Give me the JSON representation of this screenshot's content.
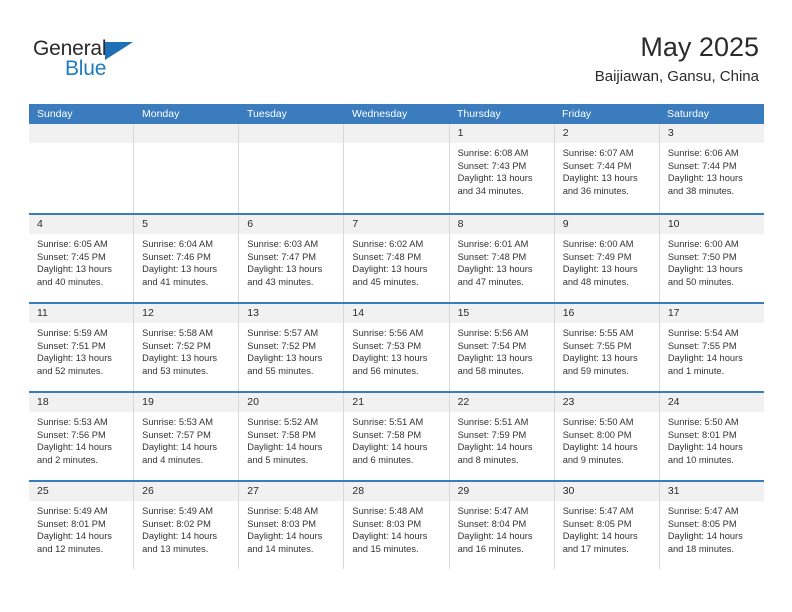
{
  "brand": {
    "name_top": "General",
    "name_bottom": "Blue",
    "triangle_color": "#1f6fb5",
    "blue_color": "#1f7bc1"
  },
  "header": {
    "title": "May 2025",
    "subtitle": "Baijiawan, Gansu, China"
  },
  "theme": {
    "header_blue": "#3b7cbe",
    "day_band": "#f1f1f1",
    "cell_border": "#d8d8d8"
  },
  "weekdays": [
    "Sunday",
    "Monday",
    "Tuesday",
    "Wednesday",
    "Thursday",
    "Friday",
    "Saturday"
  ],
  "weeks": [
    [
      {
        "day": "",
        "empty": true
      },
      {
        "day": "",
        "empty": true
      },
      {
        "day": "",
        "empty": true
      },
      {
        "day": "",
        "empty": true
      },
      {
        "day": "1",
        "sunrise": "Sunrise: 6:08 AM",
        "sunset": "Sunset: 7:43 PM",
        "daylight_1": "Daylight: 13 hours",
        "daylight_2": "and 34 minutes."
      },
      {
        "day": "2",
        "sunrise": "Sunrise: 6:07 AM",
        "sunset": "Sunset: 7:44 PM",
        "daylight_1": "Daylight: 13 hours",
        "daylight_2": "and 36 minutes."
      },
      {
        "day": "3",
        "sunrise": "Sunrise: 6:06 AM",
        "sunset": "Sunset: 7:44 PM",
        "daylight_1": "Daylight: 13 hours",
        "daylight_2": "and 38 minutes."
      }
    ],
    [
      {
        "day": "4",
        "sunrise": "Sunrise: 6:05 AM",
        "sunset": "Sunset: 7:45 PM",
        "daylight_1": "Daylight: 13 hours",
        "daylight_2": "and 40 minutes."
      },
      {
        "day": "5",
        "sunrise": "Sunrise: 6:04 AM",
        "sunset": "Sunset: 7:46 PM",
        "daylight_1": "Daylight: 13 hours",
        "daylight_2": "and 41 minutes."
      },
      {
        "day": "6",
        "sunrise": "Sunrise: 6:03 AM",
        "sunset": "Sunset: 7:47 PM",
        "daylight_1": "Daylight: 13 hours",
        "daylight_2": "and 43 minutes."
      },
      {
        "day": "7",
        "sunrise": "Sunrise: 6:02 AM",
        "sunset": "Sunset: 7:48 PM",
        "daylight_1": "Daylight: 13 hours",
        "daylight_2": "and 45 minutes."
      },
      {
        "day": "8",
        "sunrise": "Sunrise: 6:01 AM",
        "sunset": "Sunset: 7:48 PM",
        "daylight_1": "Daylight: 13 hours",
        "daylight_2": "and 47 minutes."
      },
      {
        "day": "9",
        "sunrise": "Sunrise: 6:00 AM",
        "sunset": "Sunset: 7:49 PM",
        "daylight_1": "Daylight: 13 hours",
        "daylight_2": "and 48 minutes."
      },
      {
        "day": "10",
        "sunrise": "Sunrise: 6:00 AM",
        "sunset": "Sunset: 7:50 PM",
        "daylight_1": "Daylight: 13 hours",
        "daylight_2": "and 50 minutes."
      }
    ],
    [
      {
        "day": "11",
        "sunrise": "Sunrise: 5:59 AM",
        "sunset": "Sunset: 7:51 PM",
        "daylight_1": "Daylight: 13 hours",
        "daylight_2": "and 52 minutes."
      },
      {
        "day": "12",
        "sunrise": "Sunrise: 5:58 AM",
        "sunset": "Sunset: 7:52 PM",
        "daylight_1": "Daylight: 13 hours",
        "daylight_2": "and 53 minutes."
      },
      {
        "day": "13",
        "sunrise": "Sunrise: 5:57 AM",
        "sunset": "Sunset: 7:52 PM",
        "daylight_1": "Daylight: 13 hours",
        "daylight_2": "and 55 minutes."
      },
      {
        "day": "14",
        "sunrise": "Sunrise: 5:56 AM",
        "sunset": "Sunset: 7:53 PM",
        "daylight_1": "Daylight: 13 hours",
        "daylight_2": "and 56 minutes."
      },
      {
        "day": "15",
        "sunrise": "Sunrise: 5:56 AM",
        "sunset": "Sunset: 7:54 PM",
        "daylight_1": "Daylight: 13 hours",
        "daylight_2": "and 58 minutes."
      },
      {
        "day": "16",
        "sunrise": "Sunrise: 5:55 AM",
        "sunset": "Sunset: 7:55 PM",
        "daylight_1": "Daylight: 13 hours",
        "daylight_2": "and 59 minutes."
      },
      {
        "day": "17",
        "sunrise": "Sunrise: 5:54 AM",
        "sunset": "Sunset: 7:55 PM",
        "daylight_1": "Daylight: 14 hours",
        "daylight_2": "and 1 minute."
      }
    ],
    [
      {
        "day": "18",
        "sunrise": "Sunrise: 5:53 AM",
        "sunset": "Sunset: 7:56 PM",
        "daylight_1": "Daylight: 14 hours",
        "daylight_2": "and 2 minutes."
      },
      {
        "day": "19",
        "sunrise": "Sunrise: 5:53 AM",
        "sunset": "Sunset: 7:57 PM",
        "daylight_1": "Daylight: 14 hours",
        "daylight_2": "and 4 minutes."
      },
      {
        "day": "20",
        "sunrise": "Sunrise: 5:52 AM",
        "sunset": "Sunset: 7:58 PM",
        "daylight_1": "Daylight: 14 hours",
        "daylight_2": "and 5 minutes."
      },
      {
        "day": "21",
        "sunrise": "Sunrise: 5:51 AM",
        "sunset": "Sunset: 7:58 PM",
        "daylight_1": "Daylight: 14 hours",
        "daylight_2": "and 6 minutes."
      },
      {
        "day": "22",
        "sunrise": "Sunrise: 5:51 AM",
        "sunset": "Sunset: 7:59 PM",
        "daylight_1": "Daylight: 14 hours",
        "daylight_2": "and 8 minutes."
      },
      {
        "day": "23",
        "sunrise": "Sunrise: 5:50 AM",
        "sunset": "Sunset: 8:00 PM",
        "daylight_1": "Daylight: 14 hours",
        "daylight_2": "and 9 minutes."
      },
      {
        "day": "24",
        "sunrise": "Sunrise: 5:50 AM",
        "sunset": "Sunset: 8:01 PM",
        "daylight_1": "Daylight: 14 hours",
        "daylight_2": "and 10 minutes."
      }
    ],
    [
      {
        "day": "25",
        "sunrise": "Sunrise: 5:49 AM",
        "sunset": "Sunset: 8:01 PM",
        "daylight_1": "Daylight: 14 hours",
        "daylight_2": "and 12 minutes."
      },
      {
        "day": "26",
        "sunrise": "Sunrise: 5:49 AM",
        "sunset": "Sunset: 8:02 PM",
        "daylight_1": "Daylight: 14 hours",
        "daylight_2": "and 13 minutes."
      },
      {
        "day": "27",
        "sunrise": "Sunrise: 5:48 AM",
        "sunset": "Sunset: 8:03 PM",
        "daylight_1": "Daylight: 14 hours",
        "daylight_2": "and 14 minutes."
      },
      {
        "day": "28",
        "sunrise": "Sunrise: 5:48 AM",
        "sunset": "Sunset: 8:03 PM",
        "daylight_1": "Daylight: 14 hours",
        "daylight_2": "and 15 minutes."
      },
      {
        "day": "29",
        "sunrise": "Sunrise: 5:47 AM",
        "sunset": "Sunset: 8:04 PM",
        "daylight_1": "Daylight: 14 hours",
        "daylight_2": "and 16 minutes."
      },
      {
        "day": "30",
        "sunrise": "Sunrise: 5:47 AM",
        "sunset": "Sunset: 8:05 PM",
        "daylight_1": "Daylight: 14 hours",
        "daylight_2": "and 17 minutes."
      },
      {
        "day": "31",
        "sunrise": "Sunrise: 5:47 AM",
        "sunset": "Sunset: 8:05 PM",
        "daylight_1": "Daylight: 14 hours",
        "daylight_2": "and 18 minutes."
      }
    ]
  ]
}
